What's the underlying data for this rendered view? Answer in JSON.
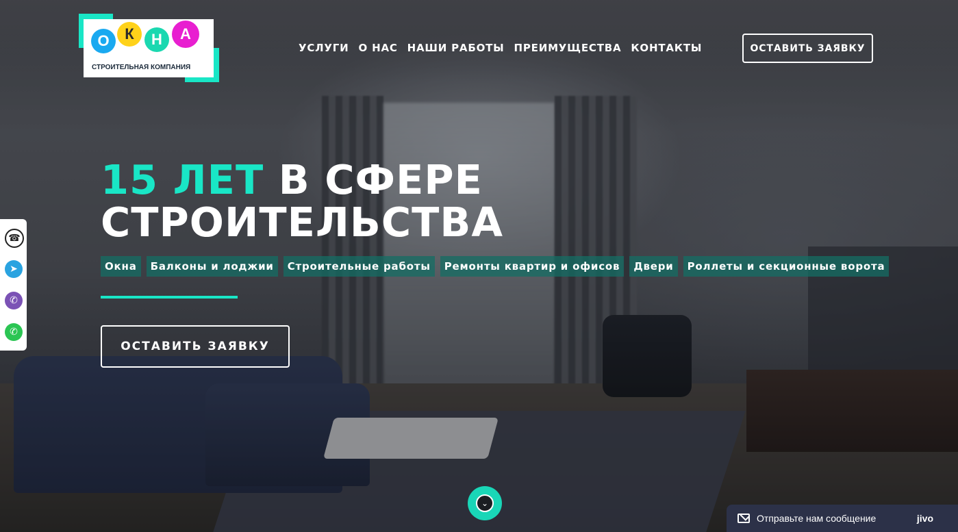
{
  "logo": {
    "letters": [
      "О",
      "К",
      "Н",
      "А"
    ],
    "tagline": "СТРОИТЕЛЬНАЯ КОМПАНИЯ"
  },
  "nav": [
    {
      "label": "УСЛУГИ"
    },
    {
      "label": "О НАС"
    },
    {
      "label": "НАШИ РАБОТЫ"
    },
    {
      "label": "ПРЕИМУЩЕСТВА"
    },
    {
      "label": "КОНТАКТЫ"
    }
  ],
  "header_button": "ОСТАВИТЬ ЗАЯВКУ",
  "social": [
    {
      "icon": "phone-icon"
    },
    {
      "icon": "telegram-icon"
    },
    {
      "icon": "viber-icon"
    },
    {
      "icon": "whatsapp-icon"
    }
  ],
  "hero": {
    "title_accent": "15 ЛЕТ",
    "title_rest": "В СФЕРЕ",
    "title_line2": "СТРОИТЕЛЬСТВА",
    "tags": [
      "Окна",
      "Балконы и лоджии",
      "Строительные работы",
      "Ремонты квартир и офисов",
      "Двери",
      "Роллеты и секционные ворота"
    ],
    "button": "ОСТАВИТЬ ЗАЯВКУ"
  },
  "chat": {
    "label": "Отправьте нам сообщение",
    "brand": "jivo"
  },
  "colors": {
    "accent": "#19e6c6",
    "chat_bg": "#2c3148"
  }
}
